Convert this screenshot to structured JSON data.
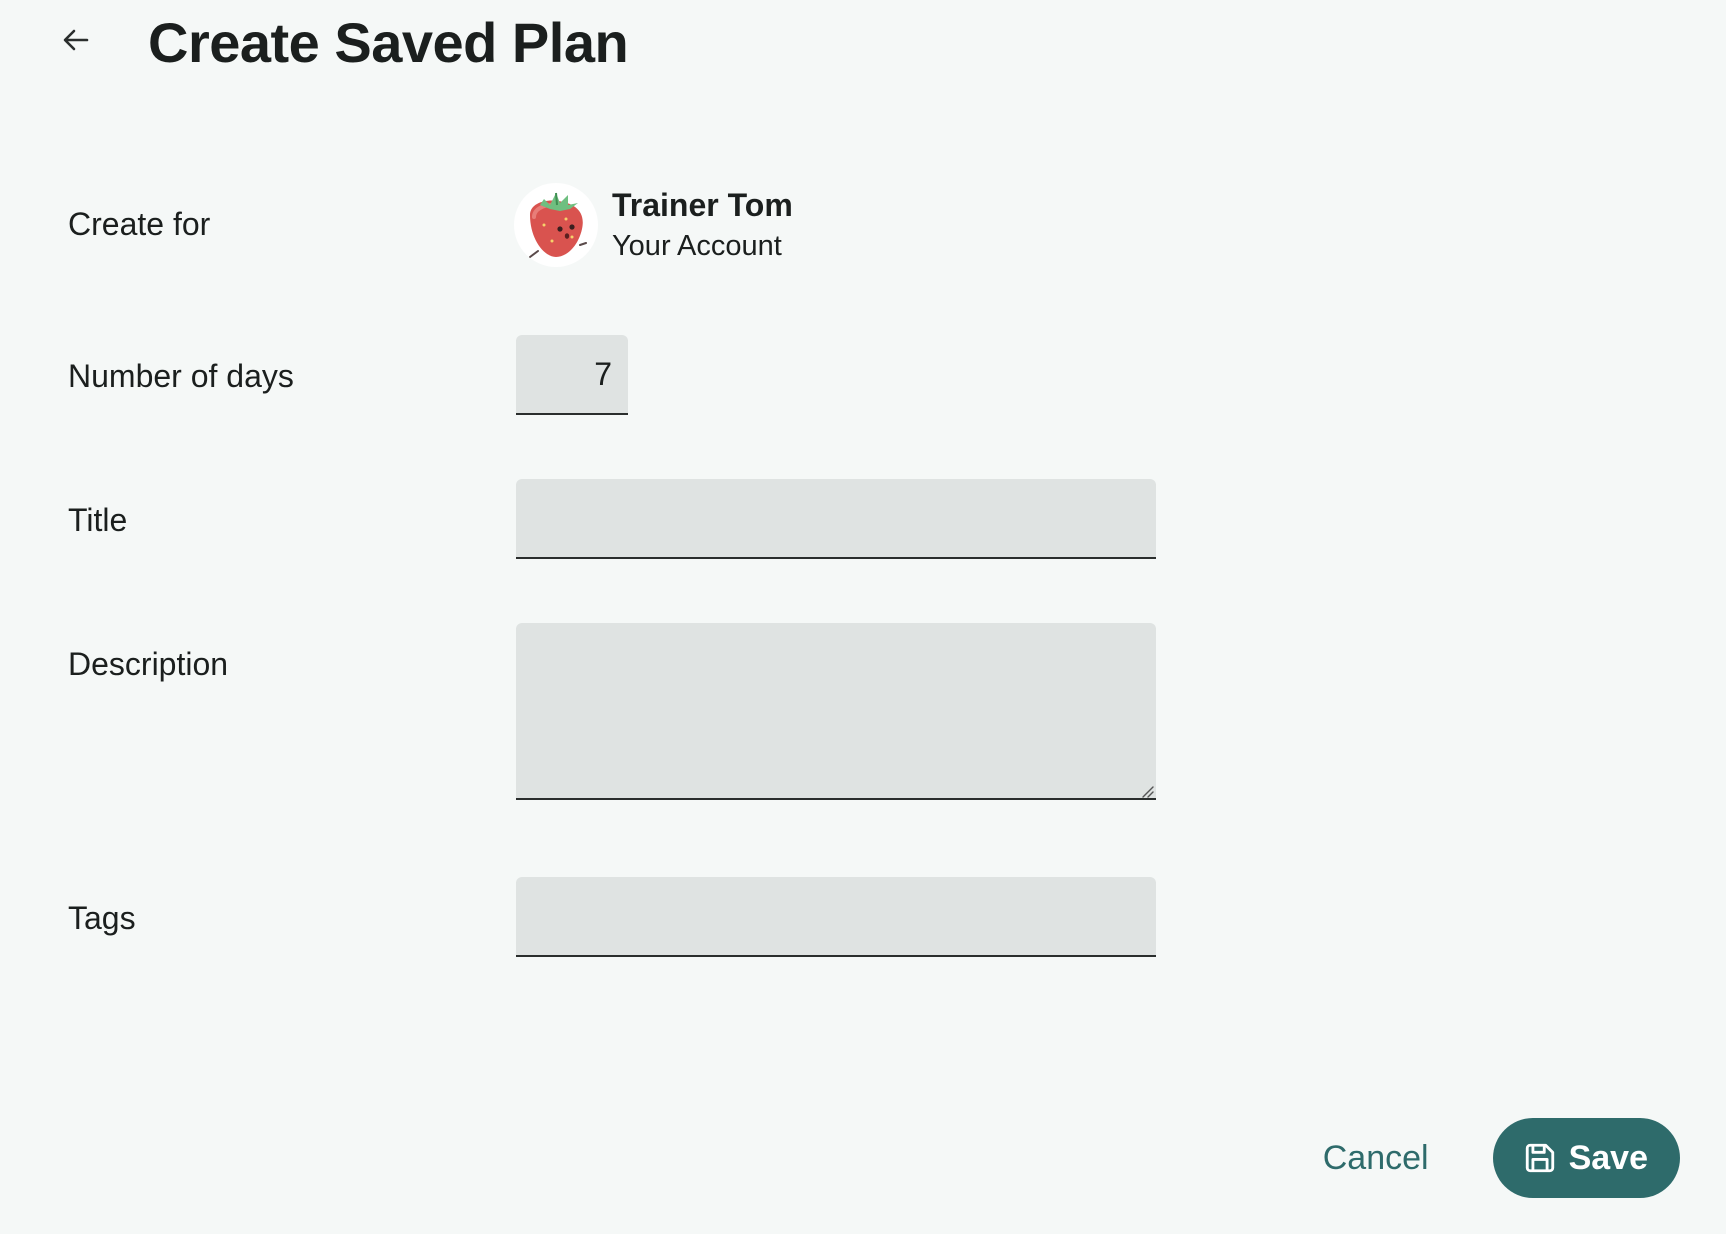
{
  "header": {
    "title": "Create Saved Plan",
    "back_icon": "arrow-left-icon"
  },
  "form": {
    "create_for": {
      "label": "Create for",
      "owner_name": "Trainer Tom",
      "owner_subtitle": "Your Account",
      "avatar_icon": "strawberry-avatar"
    },
    "days": {
      "label": "Number of days",
      "value": "7"
    },
    "title": {
      "label": "Title",
      "value": "",
      "placeholder": ""
    },
    "description": {
      "label": "Description",
      "value": "",
      "placeholder": ""
    },
    "tags": {
      "label": "Tags",
      "value": "",
      "placeholder": ""
    }
  },
  "actions": {
    "cancel_label": "Cancel",
    "save_label": "Save",
    "save_icon": "floppy-disk-icon"
  },
  "colors": {
    "background": "#f5f8f7",
    "accent": "#2e6b6b",
    "input_fill": "#dfe3e2",
    "text": "#1b1f1e"
  }
}
